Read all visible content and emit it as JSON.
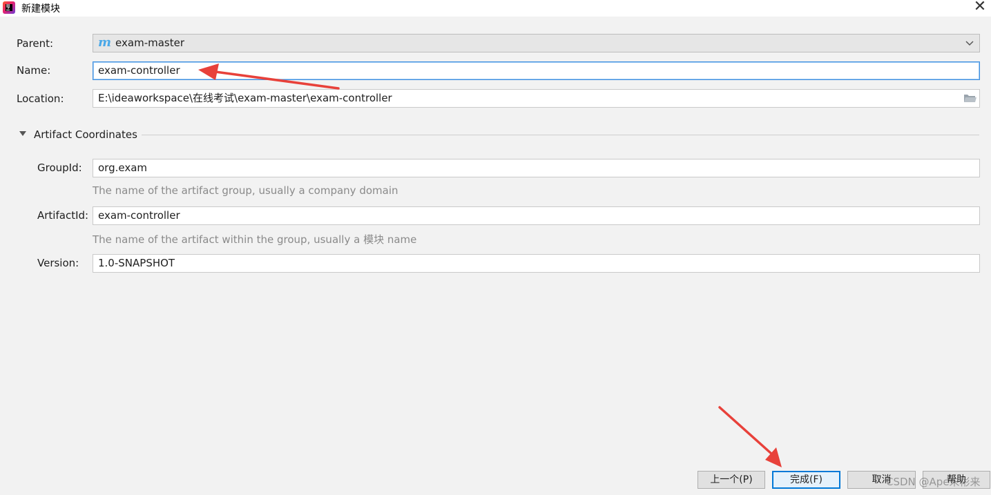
{
  "window": {
    "title": "新建模块",
    "close_glyph": "✕"
  },
  "form": {
    "parent": {
      "label": "Parent:",
      "icon_glyph": "m",
      "value": "exam-master"
    },
    "name": {
      "label": "Name:",
      "value": "exam-controller"
    },
    "location": {
      "label": "Location:",
      "value": "E:\\ideaworkspace\\在线考试\\exam-master\\exam-controller"
    }
  },
  "artifact": {
    "section_title": "Artifact Coordinates",
    "group_id": {
      "label": "GroupId:",
      "value": "org.exam",
      "hint": "The name of the artifact group, usually a company domain"
    },
    "artifact_id": {
      "label": "ArtifactId:",
      "value": "exam-controller",
      "hint": "The name of the artifact within the group, usually a 模块 name"
    },
    "version": {
      "label": "Version:",
      "value": "1.0-SNAPSHOT"
    }
  },
  "buttons": {
    "previous": "上一个(P)",
    "finish": "完成(F)",
    "cancel": "取消",
    "help": "帮助"
  },
  "watermark": "CSDN @Ape未彬来",
  "colors": {
    "annotation_arrow": "#e8413a",
    "focus_border": "#3d8ee0",
    "maven_icon": "#4aa8e8"
  }
}
